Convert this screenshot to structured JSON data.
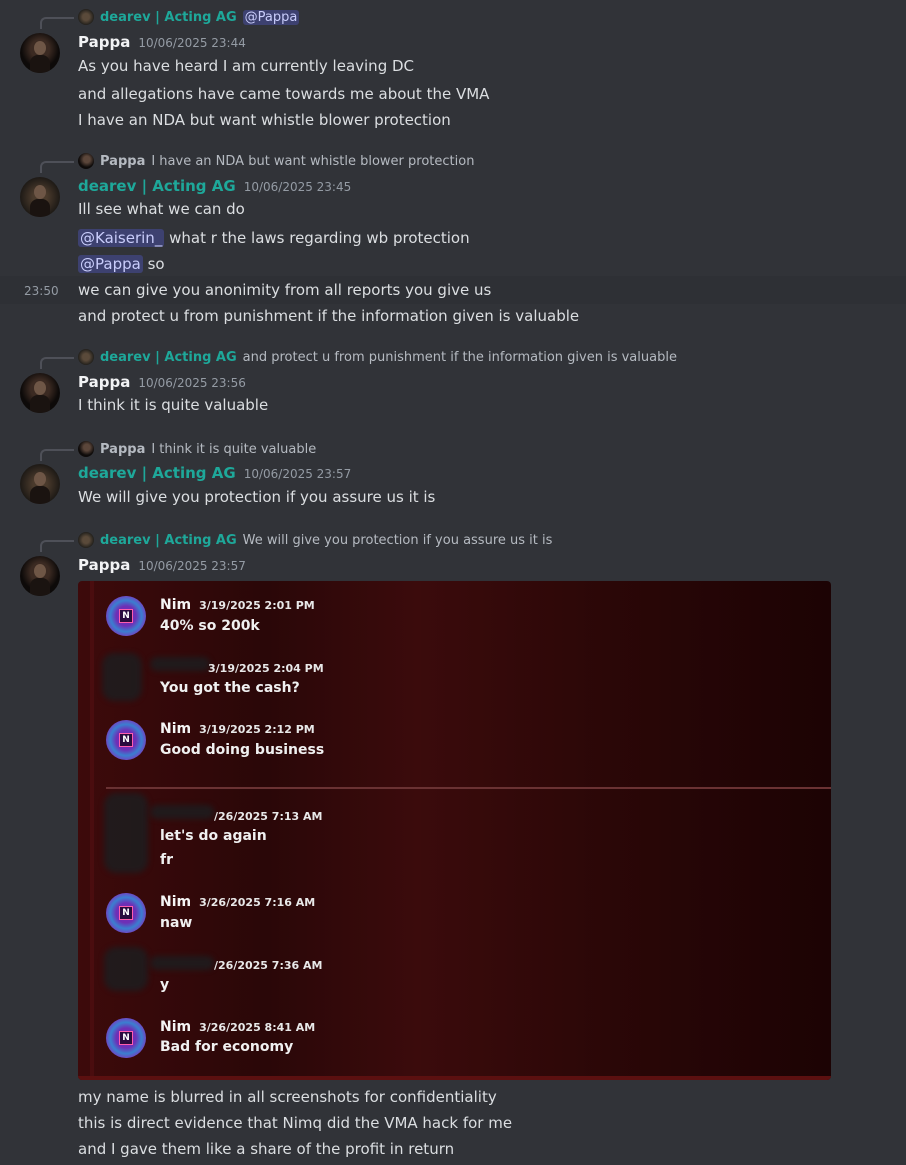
{
  "colors": {
    "background": "#313338",
    "teal_name": "#1ea89a",
    "mention_bg": "#3c4270",
    "embed_bg": "#3d0a0b"
  },
  "groups": [
    {
      "reply": {
        "user": "dearev | Acting AG",
        "text": "@Pappa",
        "is_mention": true
      },
      "user": "Pappa",
      "timestamp": "10/06/2025 23:44",
      "lines": [
        "As you have heard I am currently leaving DC",
        "and allegations have came towards me about the VMA",
        "I have an NDA but want whistle blower protection"
      ]
    },
    {
      "reply": {
        "user": "Pappa",
        "text": "I have an NDA but want whistle blower protection"
      },
      "user": "dearev | Acting AG",
      "timestamp": "10/06/2025 23:45",
      "line1": "Ill see what we can do",
      "line2_mention": "@Kaiserin_",
      "line2_text": " what r the laws regarding wb protection",
      "line3_mention": "@Pappa",
      "line3_text": " so",
      "side_time": "23:50",
      "line4": "we can give you anonimity from all reports you give us",
      "line5": "and protect u from punishment if the information given is valuable"
    },
    {
      "reply": {
        "user": "dearev | Acting AG",
        "text": "and protect u from punishment if the information given is valuable"
      },
      "user": "Pappa",
      "timestamp": "10/06/2025 23:56",
      "lines": [
        "I think it is quite valuable"
      ]
    },
    {
      "reply": {
        "user": "Pappa",
        "text": "I think it is quite valuable"
      },
      "user": "dearev | Acting AG",
      "timestamp": "10/06/2025 23:57",
      "lines": [
        "We will give you protection if you assure us it is"
      ]
    },
    {
      "reply": {
        "user": "dearev | Acting AG",
        "text": "We will give you protection if you assure us it is"
      },
      "user": "Pappa",
      "timestamp": "10/06/2025 23:57",
      "after_lines": [
        "my name is blurred in all screenshots for confidentiality",
        "this is direct evidence that Nimq did the VMA hack for me",
        "and I gave them like a share of the profit in return"
      ]
    }
  ],
  "embed": {
    "avatar_letter": "N",
    "messages": [
      {
        "user": "Nim",
        "timestamp": "3/19/2025 2:01 PM",
        "lines": [
          "40% so 200k"
        ]
      },
      {
        "user": "",
        "timestamp": "3/19/2025 2:04 PM",
        "lines": [
          "You got the cash?"
        ],
        "blurred": true
      },
      {
        "user": "Nim",
        "timestamp": "3/19/2025 2:12 PM",
        "lines": [
          "Good doing business"
        ]
      },
      {
        "user": "",
        "timestamp": "/26/2025 7:13 AM",
        "lines": [
          "let's do again",
          "fr"
        ],
        "blurred": true
      },
      {
        "user": "Nim",
        "timestamp": "3/26/2025 7:16 AM",
        "lines": [
          "naw"
        ]
      },
      {
        "user": "",
        "timestamp": "/26/2025 7:36 AM",
        "lines": [
          "y"
        ],
        "blurred": true
      },
      {
        "user": "Nim",
        "timestamp": "3/26/2025 8:41 AM",
        "lines": [
          "Bad for economy"
        ]
      }
    ]
  }
}
